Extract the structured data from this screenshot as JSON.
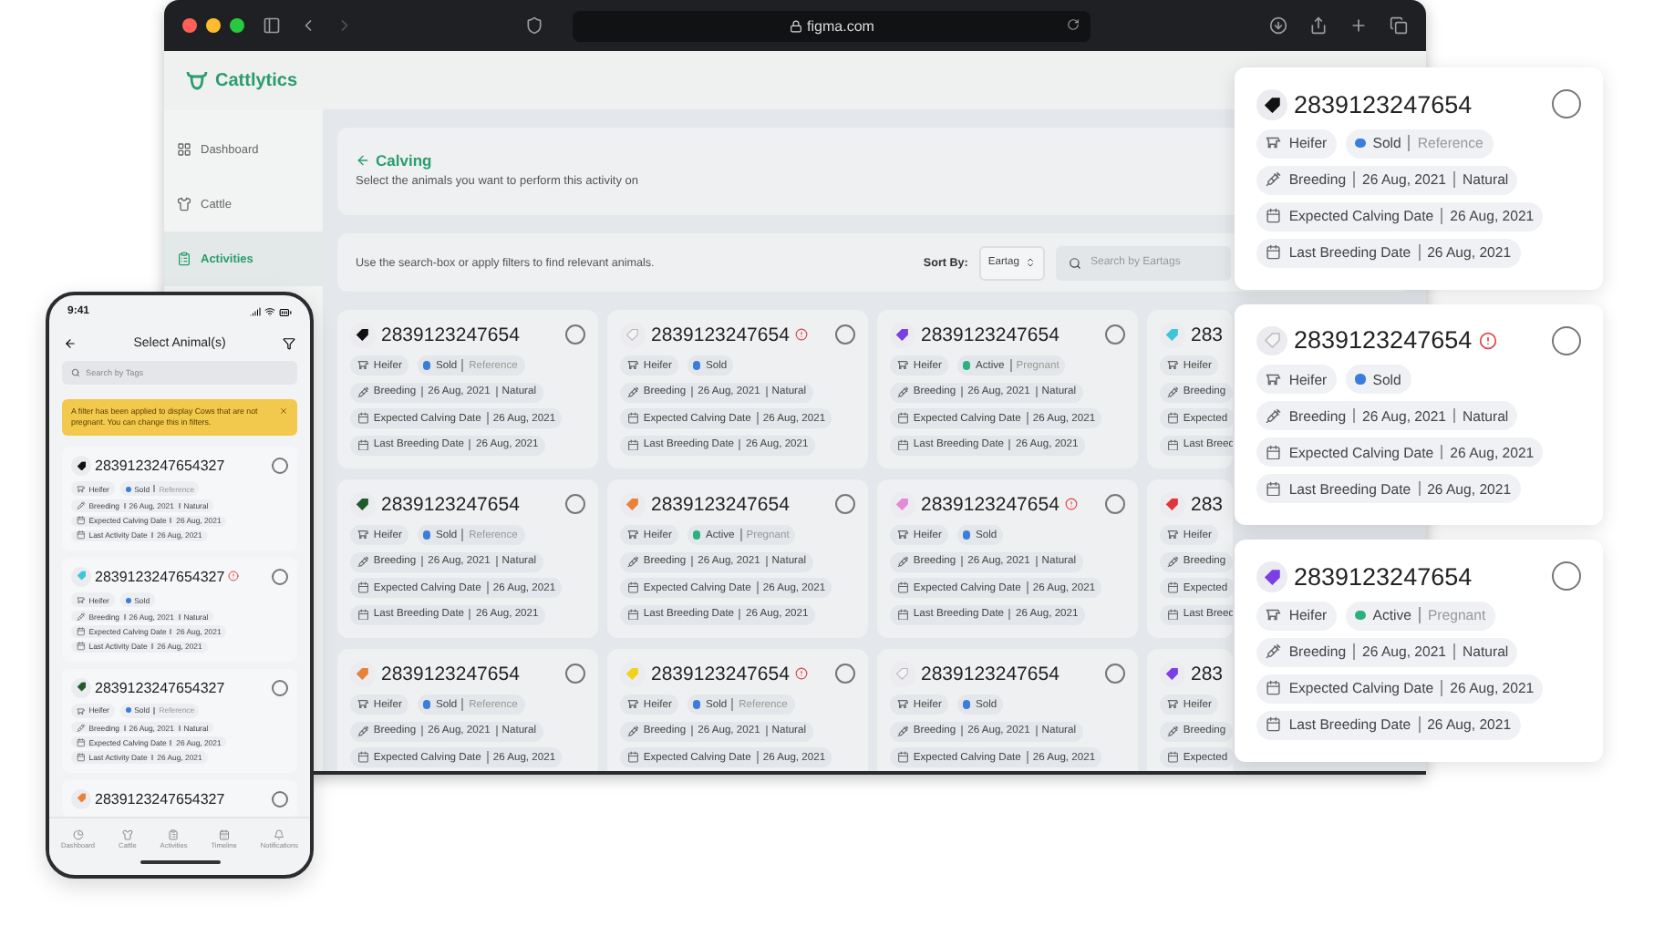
{
  "browser": {
    "address": "figma.com"
  },
  "app": {
    "logo": "Cattlytics",
    "nav": [
      {
        "label": "Dashboard",
        "kind": "grid",
        "selected": false
      },
      {
        "label": "Cattle",
        "kind": "cattle",
        "selected": false
      },
      {
        "label": "Activities",
        "kind": "list",
        "selected": true
      }
    ],
    "header": {
      "title": "Calving",
      "subtitle": "Select the animals you want to perform this activity on"
    },
    "filter_bar": {
      "hint": "Use the search-box or apply filters to find relevant animals.",
      "sort_label": "Sort By:",
      "sort_value": "Eartag",
      "search_placeholder": "Search by Eartags"
    },
    "cards": [
      {
        "tag": "2839123247654",
        "color": "#111111",
        "alert": false,
        "selected": false,
        "type": "Heifer",
        "status": {
          "label": "Sold",
          "color": "#3b7ddd",
          "note": "Reference"
        },
        "breeding": [
          "Breeding",
          "26 Aug, 2021",
          "Natural"
        ],
        "dates": [
          {
            "label": "Expected Calving Date",
            "value": "26 Aug, 2021"
          },
          {
            "label": "Last Breeding Date",
            "value": "26 Aug, 2021"
          }
        ]
      },
      {
        "tag": "2839123247654",
        "color": "#f4f4f4",
        "alert": true,
        "selected": false,
        "type": "Heifer",
        "status": {
          "label": "Sold",
          "color": "#3b7ddd"
        },
        "breeding": [
          "Breeding",
          "26 Aug, 2021",
          "Natural"
        ],
        "dates": [
          {
            "label": "Expected Calving Date",
            "value": "26 Aug, 2021"
          },
          {
            "label": "Last Breeding Date",
            "value": "26 Aug, 2021"
          }
        ]
      },
      {
        "tag": "2839123247654",
        "color": "#7b3fe4",
        "alert": false,
        "selected": false,
        "type": "Heifer",
        "status": {
          "label": "Active",
          "color": "#2bb07f",
          "note": "Pregnant"
        },
        "breeding": [
          "Breeding",
          "26 Aug, 2021",
          "Natural"
        ],
        "dates": [
          {
            "label": "Expected Calving Date",
            "value": "26 Aug, 2021"
          },
          {
            "label": "Last Breeding Date",
            "value": "26 Aug, 2021"
          }
        ]
      },
      {
        "tag": "283",
        "color": "#3cc6d8",
        "type": "Heifer",
        "breeding": [
          "Breeding"
        ],
        "dates": [
          {
            "label": "Expected"
          },
          {
            "label": "Last Breed"
          }
        ]
      },
      {
        "tag": "2839123247654",
        "color": "#1f5c2a",
        "alert": false,
        "selected": false,
        "type": "Heifer",
        "status": {
          "label": "Sold",
          "color": "#3b7ddd",
          "note": "Reference"
        },
        "breeding": [
          "Breeding",
          "26 Aug, 2021",
          "Natural"
        ],
        "dates": [
          {
            "label": "Expected Calving Date",
            "value": "26 Aug, 2021"
          },
          {
            "label": "Last Breeding Date",
            "value": "26 Aug, 2021"
          }
        ]
      },
      {
        "tag": "2839123247654",
        "color": "#e8823a",
        "alert": false,
        "selected": false,
        "type": "Heifer",
        "status": {
          "label": "Active",
          "color": "#2bb07f",
          "note": "Pregnant"
        },
        "breeding": [
          "Breeding",
          "26 Aug, 2021",
          "Natural"
        ],
        "dates": [
          {
            "label": "Expected Calving Date",
            "value": "26 Aug, 2021"
          },
          {
            "label": "Last Breeding Date",
            "value": "26 Aug, 2021"
          }
        ]
      },
      {
        "tag": "2839123247654",
        "color": "#e48ad8",
        "alert": true,
        "selected": false,
        "type": "Heifer",
        "status": {
          "label": "Sold",
          "color": "#3b7ddd"
        },
        "breeding": [
          "Breeding",
          "26 Aug, 2021",
          "Natural"
        ],
        "dates": [
          {
            "label": "Expected Calving Date",
            "value": "26 Aug, 2021"
          },
          {
            "label": "Last Breeding Date",
            "value": "26 Aug, 2021"
          }
        ]
      },
      {
        "tag": "283",
        "color": "#e0363a",
        "type": "Heifer",
        "breeding": [
          "Breeding"
        ],
        "dates": [
          {
            "label": "Expected"
          },
          {
            "label": "Last Breed"
          }
        ]
      },
      {
        "tag": "2839123247654",
        "color": "#e8823a",
        "alert": false,
        "selected": false,
        "type": "Heifer",
        "status": {
          "label": "Sold",
          "color": "#3b7ddd",
          "note": "Reference"
        },
        "breeding": [
          "Breeding",
          "26 Aug, 2021",
          "Natural"
        ],
        "dates": [
          {
            "label": "Expected Calving Date",
            "value": "26 Aug, 2021"
          }
        ]
      },
      {
        "tag": "2839123247654",
        "color": "#f0d21c",
        "alert": true,
        "selected": false,
        "type": "Heifer",
        "status": {
          "label": "Sold",
          "color": "#3b7ddd",
          "note": "Reference"
        },
        "breeding": [
          "Breeding",
          "26 Aug, 2021",
          "Natural"
        ],
        "dates": [
          {
            "label": "Expected Calving Date",
            "value": "26 Aug, 2021"
          }
        ]
      },
      {
        "tag": "2839123247654",
        "color": "#f4f4f4",
        "alert": false,
        "selected": false,
        "type": "Heifer",
        "status": {
          "label": "Sold",
          "color": "#3b7ddd"
        },
        "breeding": [
          "Breeding",
          "26 Aug, 2021",
          "Natural"
        ],
        "dates": [
          {
            "label": "Expected Calving Date",
            "value": "26 Aug, 2021"
          }
        ]
      },
      {
        "tag": "283",
        "color": "#7b3fe4",
        "type": "Heifer",
        "breeding": [
          "Breeding"
        ],
        "dates": [
          {
            "label": "Expected"
          }
        ]
      }
    ]
  },
  "phone": {
    "time": "9:41",
    "title": "Select Animal(s)",
    "search_placeholder": "Search by Tags",
    "banner": "A filter has been applied to display Cows that are not pregnant. You can change this in filters.",
    "cards": [
      {
        "tag": "2839123247654327",
        "color": "#111111",
        "alert": false,
        "selected": false,
        "type": "Heifer",
        "status": {
          "label": "Sold",
          "color": "#3b7ddd",
          "note": "Reference"
        },
        "breeding": [
          "Breeding",
          "26 Aug, 2021",
          "Natural"
        ],
        "dates": [
          {
            "label": "Expected Calving Date",
            "value": "26 Aug, 2021"
          },
          {
            "label": "Last Activity Date",
            "value": "26 Aug, 2021"
          }
        ]
      },
      {
        "tag": "2839123247654327",
        "color": "#3cc6d8",
        "alert": true,
        "selected": false,
        "type": "Heifer",
        "status": {
          "label": "Sold",
          "color": "#3b7ddd"
        },
        "breeding": [
          "Breeding",
          "26 Aug, 2021",
          "Natural"
        ],
        "dates": [
          {
            "label": "Expected Calving Date",
            "value": "26 Aug, 2021"
          },
          {
            "label": "Last Activity Date",
            "value": "26 Aug, 2021"
          }
        ]
      },
      {
        "tag": "2839123247654327",
        "color": "#1f5c2a",
        "alert": false,
        "selected": false,
        "type": "Heifer",
        "status": {
          "label": "Sold",
          "color": "#3b7ddd",
          "note": "Reference"
        },
        "breeding": [
          "Breeding",
          "26 Aug, 2021",
          "Natural"
        ],
        "dates": [
          {
            "label": "Expected Calving Date",
            "value": "26 Aug, 2021"
          },
          {
            "label": "Last Activity Date",
            "value": "26 Aug, 2021"
          }
        ]
      },
      {
        "tag": "2839123247654327",
        "color": "#e8823a",
        "alert": false,
        "selected": false
      }
    ],
    "tabs": [
      {
        "label": "Dashboard",
        "kind": "dashboard",
        "selected": false
      },
      {
        "label": "Cattle",
        "kind": "cattle",
        "selected": false
      },
      {
        "label": "Activities",
        "kind": "activities",
        "selected": false
      },
      {
        "label": "Timeline",
        "kind": "timeline",
        "selected": false
      },
      {
        "label": "Notifications",
        "kind": "bell",
        "selected": false
      }
    ]
  },
  "floating_cards": [
    {
      "tag": "2839123247654",
      "color": "#111111",
      "alert": false,
      "selected": false,
      "type": "Heifer",
      "status": {
        "label": "Sold",
        "color": "#3b7ddd",
        "note": "Reference"
      },
      "breeding": [
        "Breeding",
        "26 Aug, 2021",
        "Natural"
      ],
      "dates": [
        {
          "label": "Expected Calving Date",
          "value": "26 Aug, 2021"
        },
        {
          "label": "Last Breeding Date",
          "value": "26 Aug, 2021"
        }
      ]
    },
    {
      "tag": "2839123247654",
      "color": "#f4f4f4",
      "alert": true,
      "selected": false,
      "type": "Heifer",
      "status": {
        "label": "Sold",
        "color": "#3b7ddd"
      },
      "breeding": [
        "Breeding",
        "26 Aug, 2021",
        "Natural"
      ],
      "dates": [
        {
          "label": "Expected Calving Date",
          "value": "26 Aug, 2021"
        },
        {
          "label": "Last Breeding Date",
          "value": "26 Aug, 2021"
        }
      ]
    },
    {
      "tag": "2839123247654",
      "color": "#7b3fe4",
      "alert": false,
      "selected": false,
      "type": "Heifer",
      "status": {
        "label": "Active",
        "color": "#2bb07f",
        "note": "Pregnant"
      },
      "breeding": [
        "Breeding",
        "26 Aug, 2021",
        "Natural"
      ],
      "dates": [
        {
          "label": "Expected Calving Date",
          "value": "26 Aug, 2021"
        },
        {
          "label": "Last Breeding Date",
          "value": "26 Aug, 2021"
        }
      ]
    }
  ]
}
